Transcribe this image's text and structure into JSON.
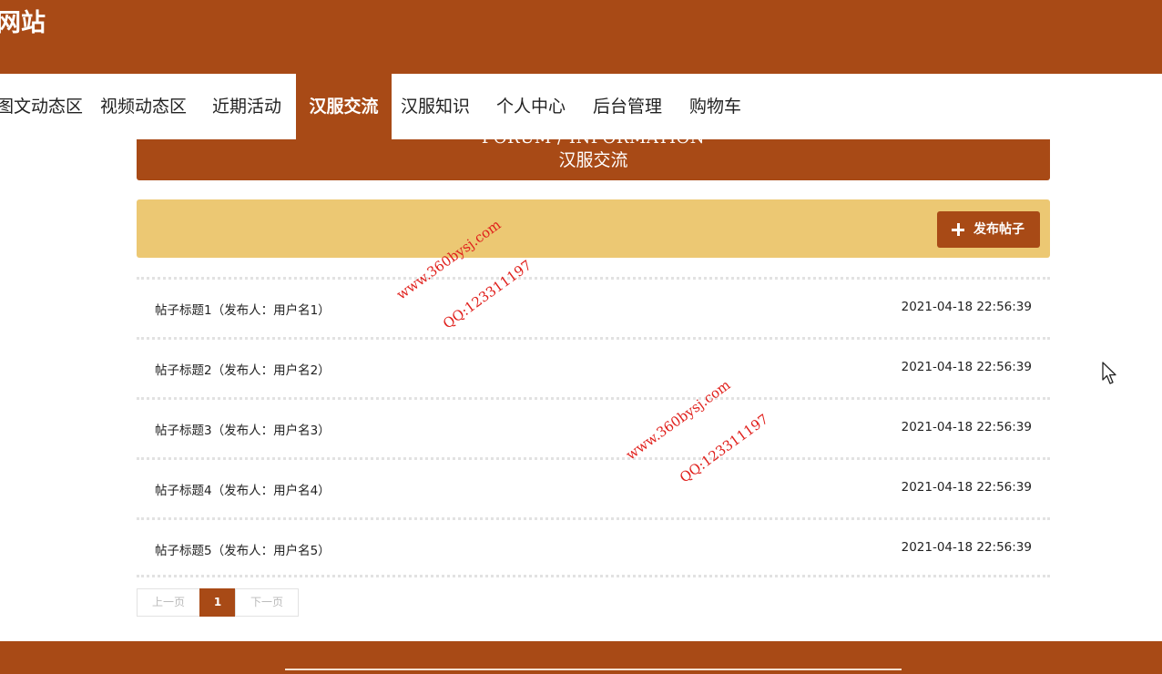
{
  "header": {
    "site_title": "网站"
  },
  "nav": {
    "items": [
      {
        "label": "图文动态区"
      },
      {
        "label": "视频动态区"
      },
      {
        "label": "近期活动"
      },
      {
        "label": "汉服交流",
        "active": true
      },
      {
        "label": "汉服知识"
      },
      {
        "label": "个人中心"
      },
      {
        "label": "后台管理"
      },
      {
        "label": "购物车"
      }
    ]
  },
  "section": {
    "title_en": "FORUM / INFORMATION",
    "title_cn": "汉服交流"
  },
  "toolbar": {
    "publish_label": "发布帖子",
    "publish_icon": "plus-icon"
  },
  "posts": [
    {
      "title": "帖子标题1（发布人：用户名1）",
      "time": "2021-04-18 22:56:39"
    },
    {
      "title": "帖子标题2（发布人：用户名2）",
      "time": "2021-04-18 22:56:39"
    },
    {
      "title": "帖子标题3（发布人：用户名3）",
      "time": "2021-04-18 22:56:39"
    },
    {
      "title": "帖子标题4（发布人：用户名4）",
      "time": "2021-04-18 22:56:39"
    },
    {
      "title": "帖子标题5（发布人：用户名5）",
      "time": "2021-04-18 22:56:39"
    }
  ],
  "pagination": {
    "prev": "上一页",
    "current": "1",
    "next": "下一页"
  },
  "watermarks": [
    {
      "text": "www.360bysj.com"
    },
    {
      "text": "QQ:123311197"
    },
    {
      "text": "www.360bysj.com"
    },
    {
      "text": "QQ:123311197"
    }
  ],
  "colors": {
    "primary": "#a84a16",
    "toolbar": "#ecc873",
    "watermark": "#e0201c"
  }
}
